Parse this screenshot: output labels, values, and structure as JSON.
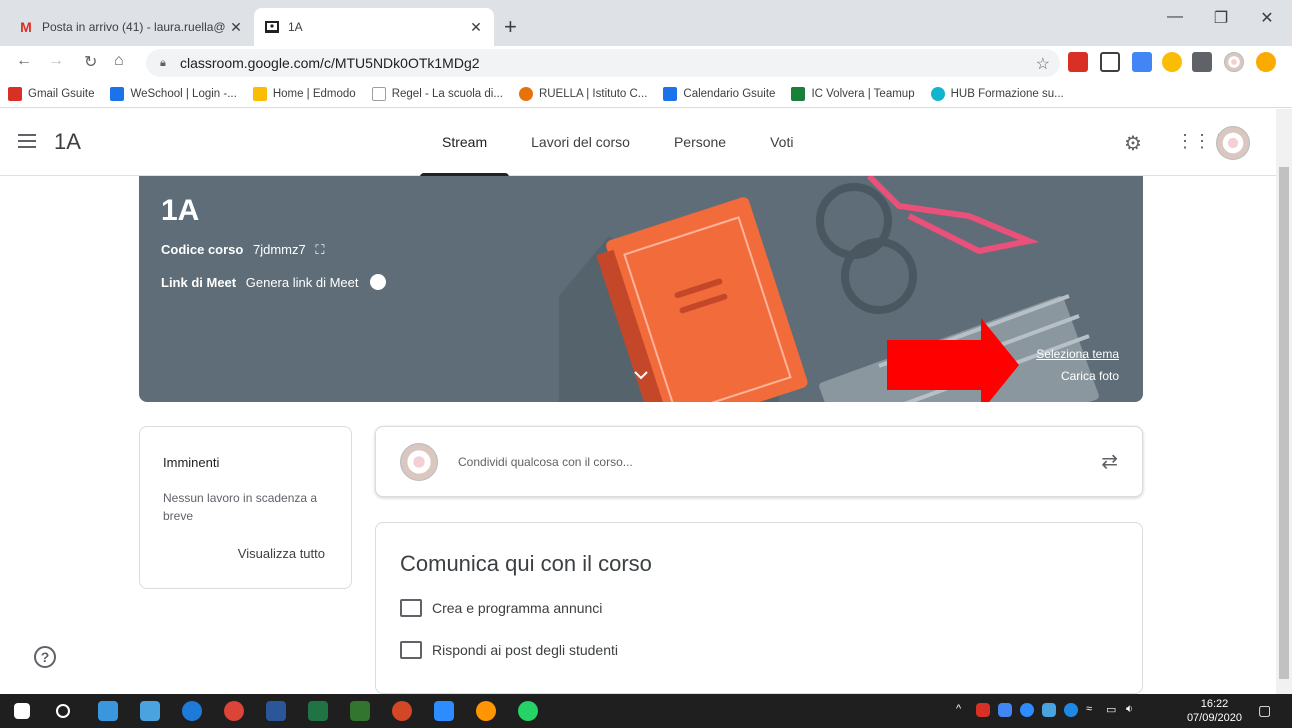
{
  "browser": {
    "tabs": [
      {
        "label": "Posta in arrivo (41) - laura.ruella@",
        "icon": "gmail-icon"
      },
      {
        "label": "1A",
        "icon": "classroom-icon"
      }
    ],
    "url": "classroom.google.com/c/MTU5NDk0OTk1MDg2",
    "bookmarks": [
      {
        "label": "Gmail Gsuite",
        "color": "#d93025"
      },
      {
        "label": "WeSchool | Login -...",
        "color": "#1a73e8"
      },
      {
        "label": "Home | Edmodo",
        "color": "#fbbc04"
      },
      {
        "label": "Regel - La scuola di...",
        "color": "#9aa0a6"
      },
      {
        "label": "RUELLA | Istituto C...",
        "color": "#e8710a"
      },
      {
        "label": "Calendario Gsuite",
        "color": "#1a73e8"
      },
      {
        "label": "IC Volvera | Teamup",
        "color": "#188038"
      },
      {
        "label": "HUB Formazione su...",
        "color": "#12b5cb"
      }
    ]
  },
  "app": {
    "class_name": "1A",
    "tabs": [
      "Stream",
      "Lavori del corso",
      "Persone",
      "Voti"
    ],
    "active_tab": "Stream"
  },
  "banner": {
    "title": "1A",
    "code_label": "Codice corso",
    "code_value": "7jdmmz7",
    "meet_label": "Link di Meet",
    "meet_value": "Genera link di Meet",
    "select_theme": "Seleziona tema",
    "upload_photo": "Carica foto"
  },
  "upcoming": {
    "title": "Imminenti",
    "text": "Nessun lavoro in scadenza a breve",
    "link": "Visualizza tutto"
  },
  "share": {
    "placeholder": "Condividi qualcosa con il corso..."
  },
  "communicate": {
    "title": "Comunica qui con il corso",
    "items": [
      "Crea e programma annunci",
      "Rispondi ai post degli studenti"
    ]
  },
  "taskbar": {
    "time": "16:22",
    "date": "07/09/2020"
  },
  "colors": {
    "banner": "#5e6d77",
    "book": "#f26b3a",
    "arrow": "#ff0000"
  }
}
